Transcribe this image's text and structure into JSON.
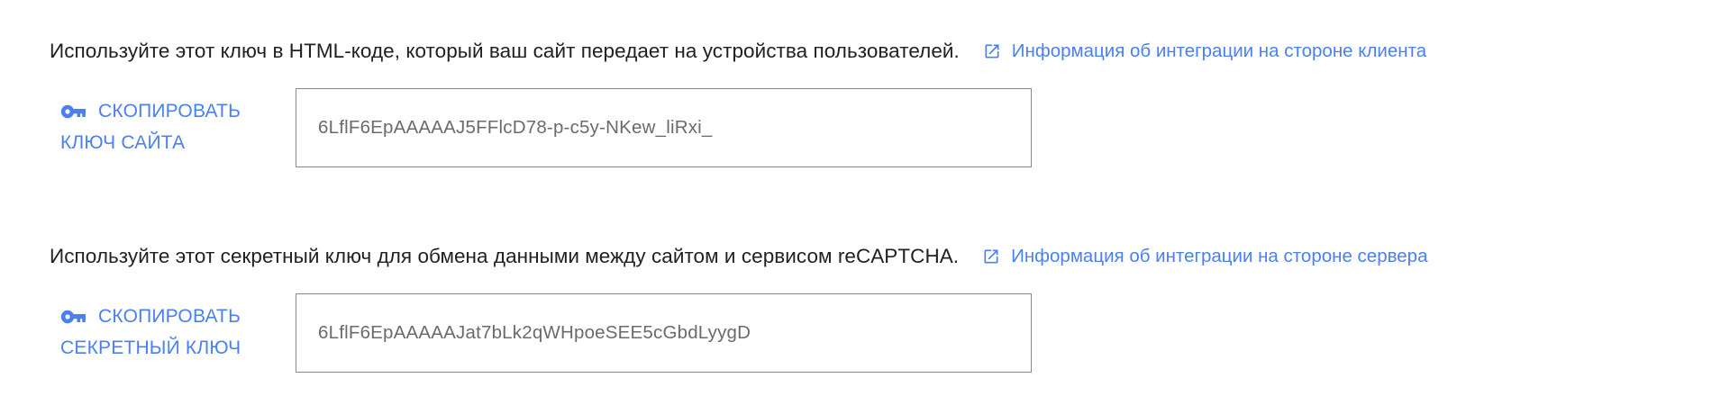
{
  "colors": {
    "link": "#4a80f0",
    "text": "#202124",
    "key_text": "#6b6b6b",
    "border": "#8a8a8a"
  },
  "site_key_section": {
    "description": "Используйте этот ключ в HTML-коде, который ваш сайт передает на устройства пользователей.",
    "doc_link_label": "Информация об интеграции на стороне клиента",
    "doc_link_icon": "open-in-new-icon",
    "copy_button_line1": "СКОПИРОВАТЬ",
    "copy_button_line2": "КЛЮЧ САЙТА",
    "copy_button_icon": "key-icon",
    "key_value": "6LflF6EpAAAAAJ5FFlcD78-p-c5y-NKew_liRxi_"
  },
  "secret_key_section": {
    "description": "Используйте этот секретный ключ для обмена данными между сайтом и сервисом reCAPTCHA.",
    "doc_link_label": "Информация об интеграции на стороне сервера",
    "doc_link_icon": "open-in-new-icon",
    "copy_button_line1": "СКОПИРОВАТЬ",
    "copy_button_line2": "СЕКРЕТНЫЙ КЛЮЧ",
    "copy_button_icon": "key-icon",
    "key_value": "6LflF6EpAAAAAJat7bLk2qWHpoeSEE5cGbdLyygD"
  }
}
